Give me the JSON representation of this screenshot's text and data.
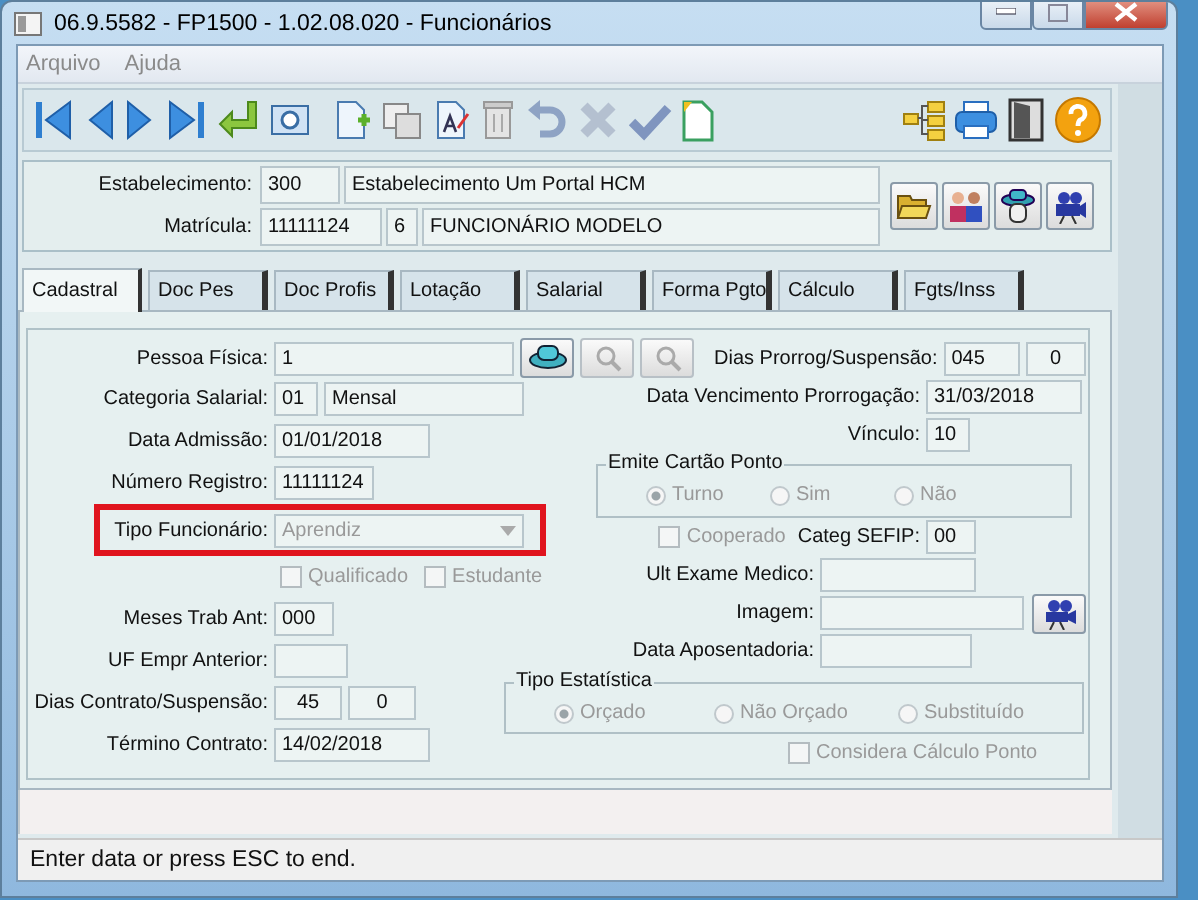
{
  "window": {
    "title": "06.9.5582 - FP1500 - 1.02.08.020 - Funcionários"
  },
  "menu": [
    "Arquivo",
    "Ajuda"
  ],
  "header": {
    "estabelecimento": {
      "label": "Estabelecimento:",
      "code": "300",
      "name": "Estabelecimento Um Portal HCM"
    },
    "matricula": {
      "label": "Matrícula:",
      "code": "11111124",
      "digit": "6",
      "name": "FUNCIONÁRIO MODELO"
    }
  },
  "tabs": [
    {
      "label": "Cadastral",
      "selected": true
    },
    {
      "label": "Doc Pes",
      "selected": false
    },
    {
      "label": "Doc Profis",
      "selected": false
    },
    {
      "label": "Lotação",
      "selected": false
    },
    {
      "label": "Salarial",
      "selected": false
    },
    {
      "label": "Forma Pgto",
      "selected": false
    },
    {
      "label": "Cálculo",
      "selected": false
    },
    {
      "label": "Fgts/Inss",
      "selected": false
    }
  ],
  "form": {
    "pessoa_fisica": {
      "label": "Pessoa Física:",
      "value": "1"
    },
    "dias_prorrog": {
      "label": "Dias Prorrog/Suspensão:",
      "value": "045",
      "value_2": "0"
    },
    "categoria_salarial": {
      "label": "Categoria Salarial:",
      "code": "01",
      "name": "Mensal"
    },
    "data_vencimento": {
      "label": "Data Vencimento Prorrogação:",
      "value": "31/03/2018"
    },
    "data_admissao": {
      "label": "Data Admissão:",
      "value": "01/01/2018"
    },
    "vinculo": {
      "label": "Vínculo:",
      "value": "10"
    },
    "numero_registro": {
      "label": "Número Registro:",
      "value": "11111124"
    },
    "emite_cartao_ponto": {
      "title": "Emite Cartão Ponto",
      "options": [
        {
          "label": "Turno",
          "selected": true
        },
        {
          "label": "Sim",
          "selected": false
        },
        {
          "label": "Não",
          "selected": false
        }
      ]
    },
    "tipo_funcionario": {
      "label": "Tipo Funcionário:",
      "value": "Aprendiz",
      "highlighted": true
    },
    "qualificado": {
      "label": "Qualificado",
      "checked": false
    },
    "estudante": {
      "label": "Estudante",
      "checked": false
    },
    "cooperado": {
      "label": "Cooperado",
      "checked": false
    },
    "categ_sefip": {
      "label": "Categ SEFIP:",
      "value": "00"
    },
    "meses_trab_ant": {
      "label": "Meses Trab Ant:",
      "value": "000"
    },
    "ult_exame_medico": {
      "label": "Ult Exame Medico:"
    },
    "uf_empr_anterior": {
      "label": "UF Empr Anterior:"
    },
    "imagem": {
      "label": "Imagem:"
    },
    "dias_contrato": {
      "label": "Dias Contrato/Suspensão:",
      "value": "45",
      "value_2": "0"
    },
    "data_aposentadoria": {
      "label": "Data Aposentadoria:"
    },
    "tipo_estatistica": {
      "title": "Tipo Estatística",
      "options": [
        {
          "label": "Orçado",
          "selected": true
        },
        {
          "label": "Não Orçado",
          "selected": false
        },
        {
          "label": "Substituído",
          "selected": false
        }
      ]
    },
    "termino_contrato": {
      "label": "Término Contrato:",
      "value": "14/02/2018"
    },
    "considera_calculo_ponto": {
      "label": "Considera Cálculo Ponto",
      "checked": false
    }
  },
  "status_bar": "Enter data or press ESC to end."
}
